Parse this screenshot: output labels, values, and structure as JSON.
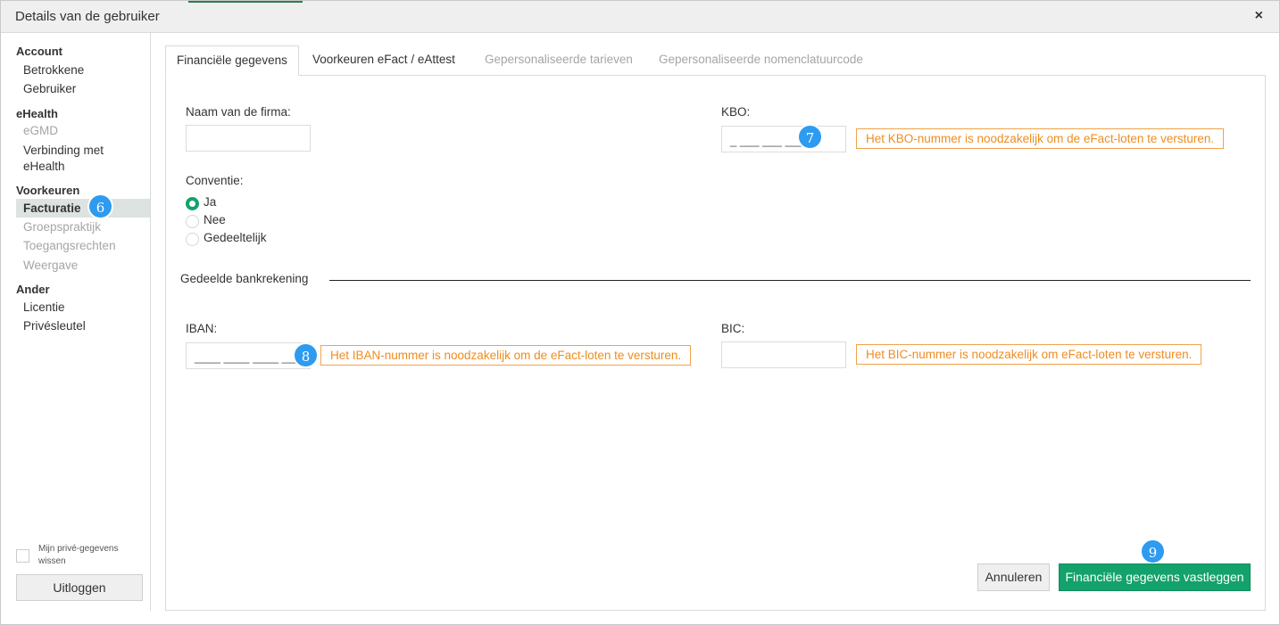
{
  "window": {
    "title": "Details van de gebruiker",
    "close_icon": "×"
  },
  "sidebar": {
    "sections": [
      {
        "label": "Account",
        "items": [
          {
            "label": "Betrokkene"
          },
          {
            "label": "Gebruiker"
          }
        ]
      },
      {
        "label": "eHealth",
        "items": [
          {
            "label": "eGMD",
            "state": "disabled"
          },
          {
            "label": "Verbinding met eHealth"
          }
        ]
      },
      {
        "label": "Voorkeuren",
        "items": [
          {
            "label": "Facturatie",
            "state": "active"
          },
          {
            "label": "Groepspraktijk",
            "state": "disabled"
          },
          {
            "label": "Toegangsrechten",
            "state": "disabled"
          },
          {
            "label": "Weergave",
            "state": "disabled"
          }
        ]
      },
      {
        "label": "Ander",
        "items": [
          {
            "label": "Licentie"
          },
          {
            "label": "Privésleutel"
          }
        ]
      }
    ],
    "privacy_checkbox_label": "Mijn privé-gegevens wissen",
    "logout_label": "Uitloggen"
  },
  "tabs": [
    {
      "label": "Financiële gegevens",
      "state": "active"
    },
    {
      "label": "Voorkeuren eFact / eAttest",
      "state": "enabled"
    },
    {
      "label": "Gepersonaliseerde tarieven",
      "state": "disabled"
    },
    {
      "label": "Gepersonaliseerde nomenclatuurcode",
      "state": "disabled"
    }
  ],
  "form": {
    "firm_name": {
      "label": "Naam van de firma:",
      "value": ""
    },
    "kbo": {
      "label": "KBO:",
      "value": "_ ___ ___ ___",
      "warning": "Het KBO-nummer is noodzakelijk om de eFact-loten te versturen."
    },
    "convention": {
      "label": "Conventie:",
      "options": [
        {
          "label": "Ja",
          "checked": true
        },
        {
          "label": "Nee",
          "checked": false
        },
        {
          "label": "Gedeeltelijk",
          "checked": false
        }
      ]
    },
    "shared_account_heading": "Gedeelde bankrekening",
    "iban": {
      "label": "IBAN:",
      "value": "____ ____ ____ ____",
      "warning": "Het IBAN-nummer is noodzakelijk om de eFact-loten te versturen."
    },
    "bic": {
      "label": "BIC:",
      "value": "",
      "warning": "Het BIC-nummer is noodzakelijk om eFact-loten te versturen."
    }
  },
  "buttons": {
    "cancel": "Annuleren",
    "save": "Financiële gegevens vastleggen"
  },
  "step_badges": [
    "6",
    "7",
    "8",
    "9"
  ],
  "colors": {
    "accent_green": "#13a26b",
    "warning_orange": "#f08c1e",
    "badge_blue": "#2d9bf0",
    "disabled_text": "#a5a5a5"
  }
}
